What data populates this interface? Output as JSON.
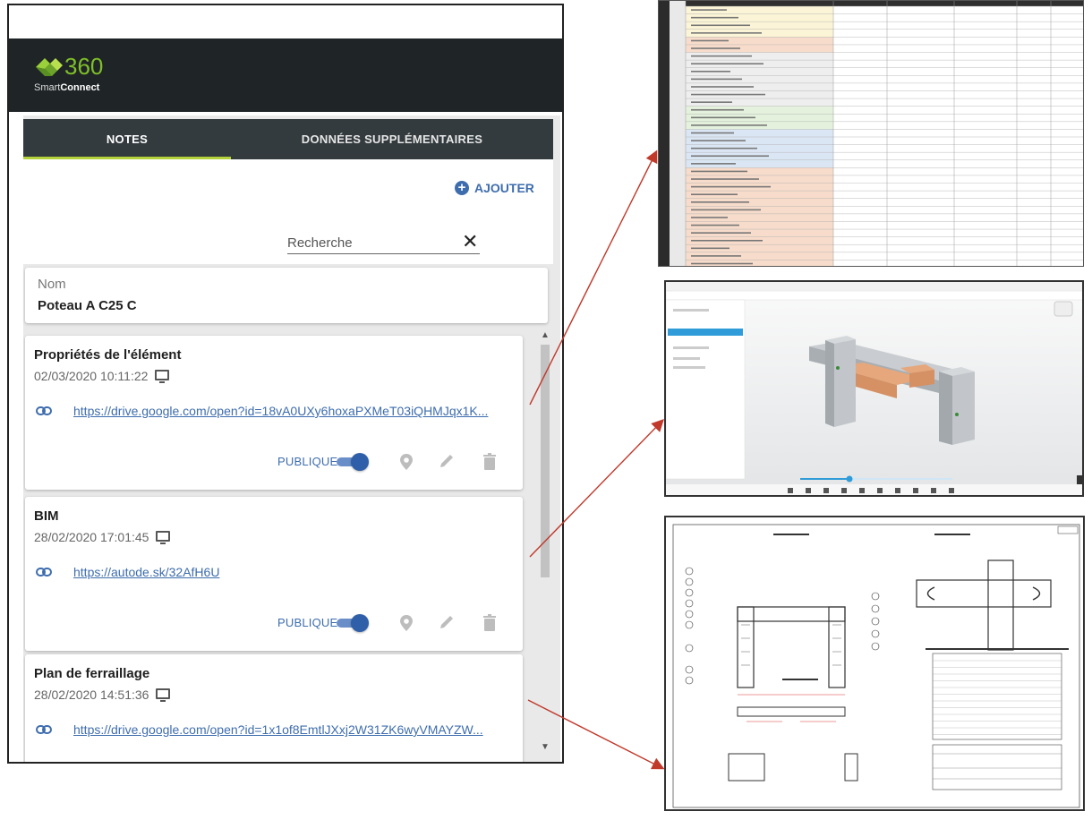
{
  "app": {
    "logo_number": "360",
    "logo_smart": "Smart",
    "logo_connect": "Connect",
    "accent_color": "#b6d23a",
    "link_color": "#3e6dad",
    "header_color": "#1f2426"
  },
  "tabs": [
    {
      "label": "NOTES",
      "active": true
    },
    {
      "label": "DONNÉES SUPPLÉMENTAIRES",
      "active": false
    }
  ],
  "toolbar": {
    "add_label": "AJOUTER",
    "add_icon": "plus-circle-icon",
    "search_placeholder": "Recherche",
    "clear_icon": "close-icon"
  },
  "element": {
    "name_label": "Nom",
    "name_value": "Poteau A C25 C"
  },
  "notes": [
    {
      "title": "Propriétés de l'élément",
      "date": "02/03/2020 10:11:22",
      "link": "https://drive.google.com/open?id=18vA0UXy6hoxaPXMeT03iQHMJqx1K...",
      "public_label": "PUBLIQUE",
      "public": true,
      "has_actions": true
    },
    {
      "title": "BIM",
      "date": "28/02/2020 17:01:45",
      "link": "https://autode.sk/32AfH6U",
      "public_label": "PUBLIQUE",
      "public": true,
      "has_actions": true
    },
    {
      "title": "Plan de ferraillage",
      "date": "28/02/2020 14:51:36",
      "link": "https://drive.google.com/open?id=1x1of8EmtlJXxj2W31ZK6wyVMAYZW...",
      "has_actions": false
    }
  ]
}
